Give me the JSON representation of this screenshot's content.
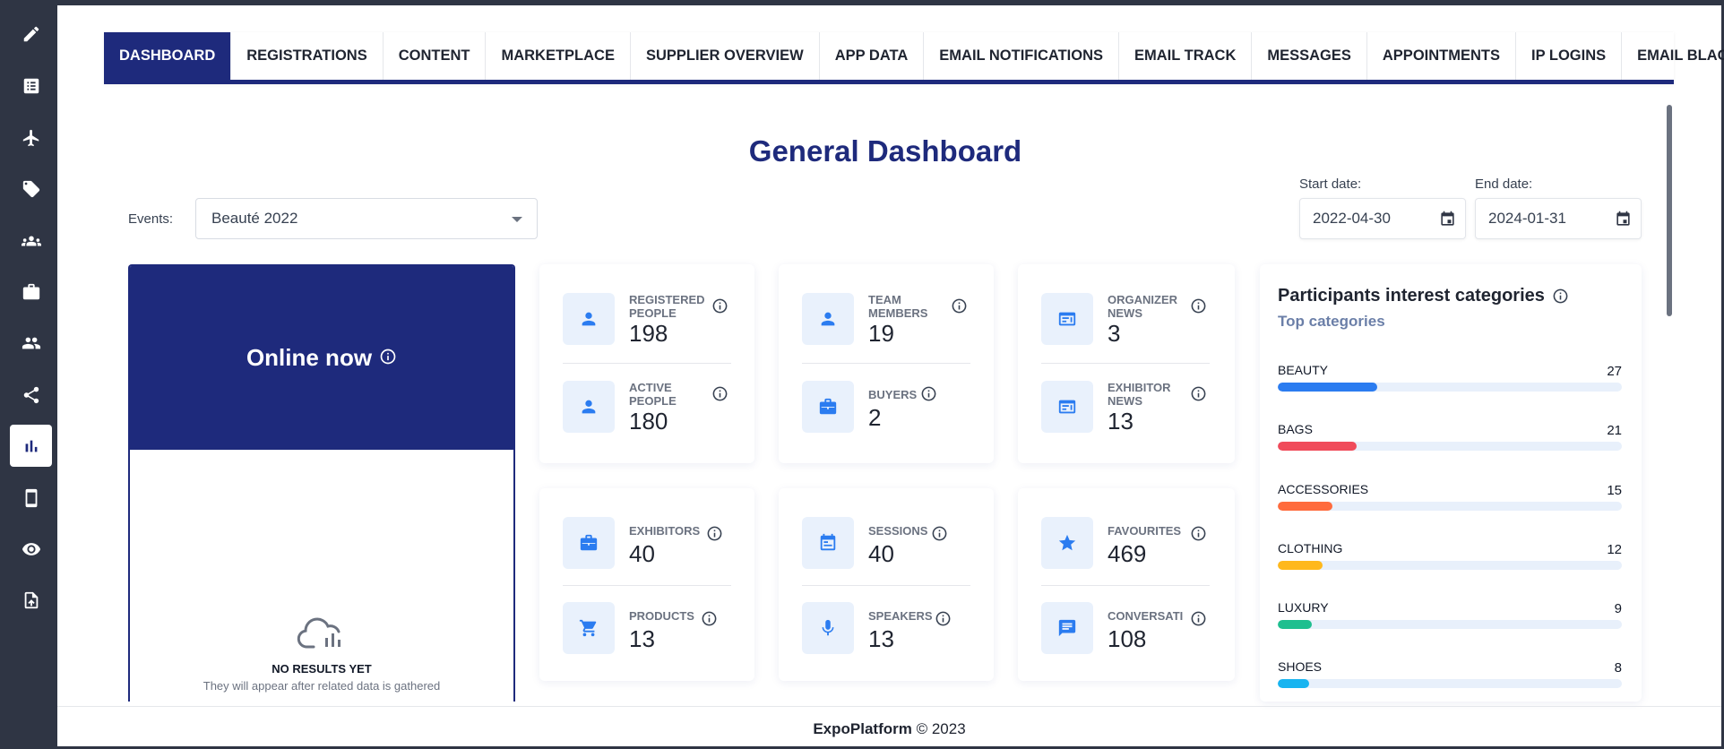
{
  "tabs": [
    {
      "label": "DASHBOARD",
      "active": true
    },
    {
      "label": "REGISTRATIONS"
    },
    {
      "label": "CONTENT"
    },
    {
      "label": "MARKETPLACE"
    },
    {
      "label": "SUPPLIER OVERVIEW"
    },
    {
      "label": "APP DATA"
    },
    {
      "label": "EMAIL NOTIFICATIONS"
    },
    {
      "label": "EMAIL TRACK"
    },
    {
      "label": "MESSAGES"
    },
    {
      "label": "APPOINTMENTS"
    },
    {
      "label": "IP LOGINS"
    },
    {
      "label": "EMAIL BLACKLIST"
    }
  ],
  "sidebar": {
    "items": [
      {
        "icon": "pencil-icon"
      },
      {
        "icon": "list-icon"
      },
      {
        "icon": "airplane-icon"
      },
      {
        "icon": "ticket-icon"
      },
      {
        "icon": "group-icon"
      },
      {
        "icon": "briefcase-icon"
      },
      {
        "icon": "people-icon"
      },
      {
        "icon": "share-icon"
      },
      {
        "icon": "bar-chart-icon",
        "active": true
      },
      {
        "icon": "mobile-icon"
      },
      {
        "icon": "eye-icon"
      },
      {
        "icon": "upload-file-icon"
      }
    ]
  },
  "page": {
    "title": "General Dashboard",
    "events_label": "Events:",
    "events_value": "Beauté 2022",
    "start_date_label": "Start date:",
    "start_date": "2022-04-30",
    "end_date_label": "End date:",
    "end_date": "2024-01-31"
  },
  "online": {
    "title": "Online now",
    "empty_title": "NO RESULTS YET",
    "empty_sub": "They will appear after related data is gathered"
  },
  "stats": {
    "registered_people": {
      "label": "REGISTERED PEOPLE",
      "value": "198"
    },
    "active_people": {
      "label": "ACTIVE PEOPLE",
      "value": "180"
    },
    "team_members": {
      "label": "TEAM MEMBERS",
      "value": "19"
    },
    "buyers": {
      "label": "BUYERS",
      "value": "2"
    },
    "organizer_news": {
      "label": "ORGANIZER NEWS",
      "value": "3"
    },
    "exhibitor_news": {
      "label": "EXHIBITOR NEWS",
      "value": "13"
    },
    "exhibitors": {
      "label": "EXHIBITORS",
      "value": "40"
    },
    "products": {
      "label": "PRODUCTS",
      "value": "13"
    },
    "sessions": {
      "label": "SESSIONS",
      "value": "40"
    },
    "speakers": {
      "label": "SPEAKERS",
      "value": "13"
    },
    "favourites": {
      "label": "FAVOURITES",
      "value": "469"
    },
    "conversations": {
      "label": "CONVERSATI",
      "value": "108"
    }
  },
  "participants": {
    "title": "Participants interest categories",
    "subtitle": "Top categories",
    "categories": [
      {
        "name": "BEAUTY",
        "count": "27",
        "fraction": 0.29,
        "color": "#2b7cf0"
      },
      {
        "name": "BAGS",
        "count": "21",
        "fraction": 0.23,
        "color": "#f04b5a"
      },
      {
        "name": "ACCESSORIES",
        "count": "15",
        "fraction": 0.16,
        "color": "#ff6b3d"
      },
      {
        "name": "CLOTHING",
        "count": "12",
        "fraction": 0.13,
        "color": "#ffb81c"
      },
      {
        "name": "LUXURY",
        "count": "9",
        "fraction": 0.1,
        "color": "#1fbf8f"
      },
      {
        "name": "SHOES",
        "count": "8",
        "fraction": 0.09,
        "color": "#18b4f0"
      }
    ]
  },
  "footer": {
    "brand": "ExpoPlatform",
    "copyright": "© 2023"
  }
}
